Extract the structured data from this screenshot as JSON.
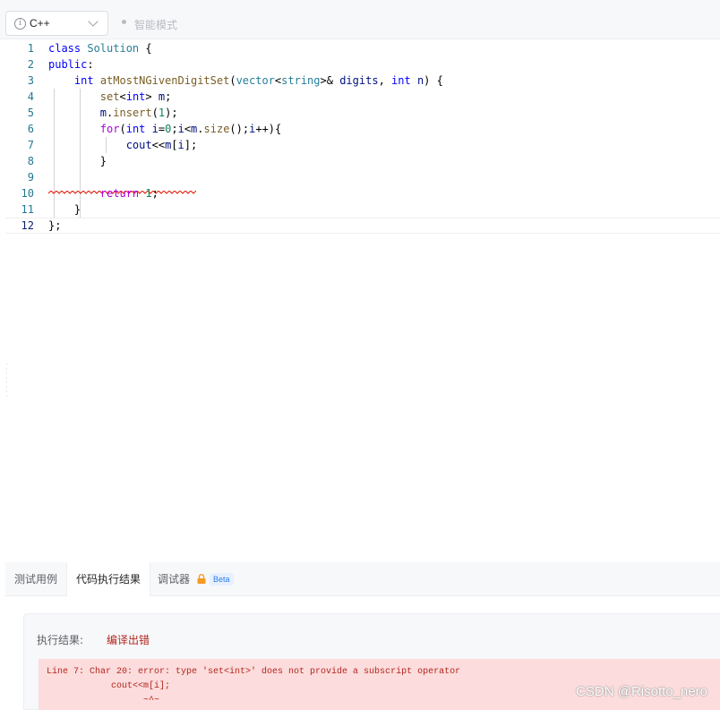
{
  "toolbar": {
    "language": "C++",
    "info_icon": "i",
    "smart_mode_label": "智能模式"
  },
  "editor": {
    "lines": [
      {
        "n": "1",
        "text": "class Solution {"
      },
      {
        "n": "2",
        "text": "public:"
      },
      {
        "n": "3",
        "text": "    int atMostNGivenDigitSet(vector<string>& digits, int n) {"
      },
      {
        "n": "4",
        "text": "        set<int> m;"
      },
      {
        "n": "5",
        "text": "        m.insert(1);"
      },
      {
        "n": "6",
        "text": "        for(int i=0;i<m.size();i++){"
      },
      {
        "n": "7",
        "text": "            cout<<m[i];"
      },
      {
        "n": "8",
        "text": "        }"
      },
      {
        "n": "9",
        "text": ""
      },
      {
        "n": "10",
        "text": "        return 1;"
      },
      {
        "n": "11",
        "text": "    }"
      },
      {
        "n": "12",
        "text": "};"
      }
    ],
    "error_line": "7",
    "active_line": "12"
  },
  "panel": {
    "tabs": [
      {
        "label": "测试用例"
      },
      {
        "label": "代码执行结果"
      },
      {
        "label": "调试器"
      }
    ],
    "active_tab": "代码执行结果",
    "beta_label": "Beta"
  },
  "result": {
    "label": "执行结果:",
    "status": "编译出错",
    "error_lines": [
      "Line 7: Char 20: error: type 'set<int>' does not provide a subscript operator",
      "            cout<<m[i];",
      "                  ~^~"
    ]
  },
  "watermark": "CSDN @Risotto_nero",
  "colors": {
    "keyword": "#0000ff",
    "control_keyword": "#af00db",
    "type": "#267f99",
    "function": "#795e26",
    "variable": "#001080",
    "number": "#098658",
    "error_text": "#b3261e",
    "error_bg": "#fcdcdc"
  }
}
